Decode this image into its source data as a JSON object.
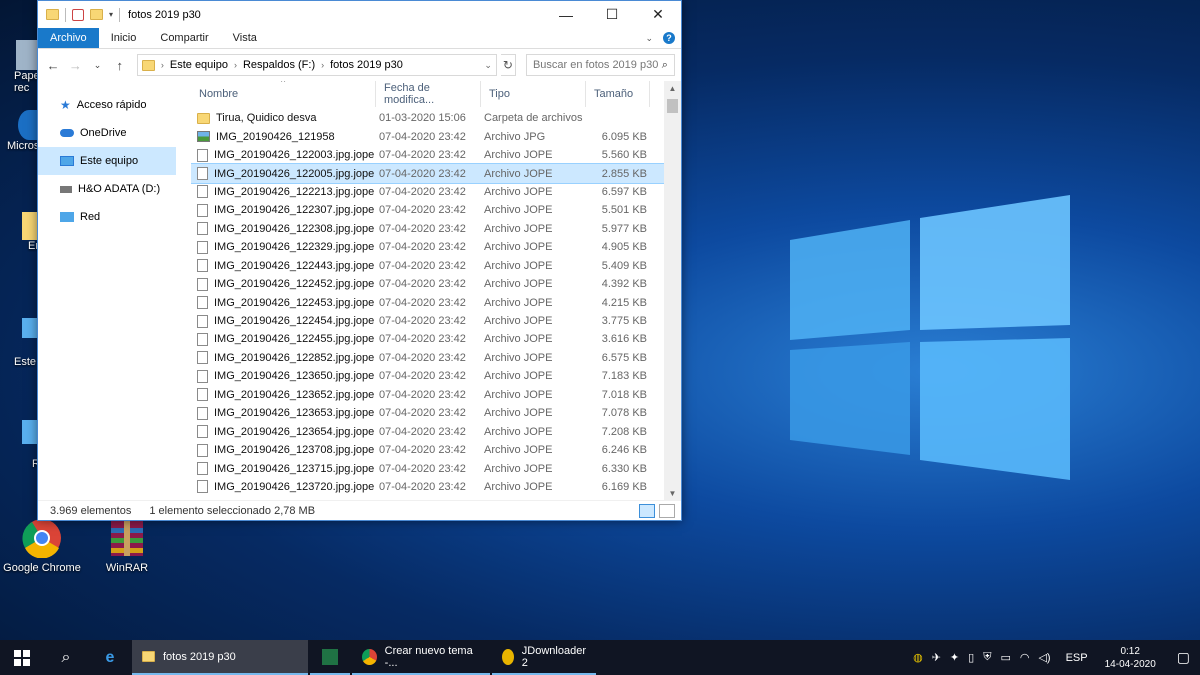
{
  "desktop": {
    "icons": [
      {
        "label": "Pape\nrec",
        "icon": "recycle-bin-icon"
      },
      {
        "label": "Micros",
        "icon": "edge-icon"
      },
      {
        "label": "En",
        "icon": "folder-icon"
      },
      {
        "label": "Este",
        "icon": "this-pc-icon"
      },
      {
        "label": "R",
        "icon": "network-icon"
      },
      {
        "label": "Google Chrome",
        "icon": "chrome-icon"
      },
      {
        "label": "WinRAR",
        "icon": "winrar-icon"
      }
    ]
  },
  "window": {
    "title": "fotos 2019 p30",
    "ribbon_tabs": [
      "Archivo",
      "Inicio",
      "Compartir",
      "Vista"
    ],
    "breadcrumb": [
      "Este equipo",
      "Respaldos (F:)",
      "fotos 2019 p30"
    ],
    "search_placeholder": "Buscar en fotos 2019 p30",
    "nav_pane": [
      {
        "label": "Acceso rápido",
        "icon": "star-icon"
      },
      {
        "label": "OneDrive",
        "icon": "cloud-icon"
      },
      {
        "label": "Este equipo",
        "icon": "computer-icon",
        "selected": true
      },
      {
        "label": "H&O ADATA (D:)",
        "icon": "drive-icon"
      },
      {
        "label": "Red",
        "icon": "network-icon"
      }
    ],
    "columns": [
      "Nombre",
      "Fecha de modifica...",
      "Tipo",
      "Tamaño"
    ],
    "files": [
      {
        "name": "Tirua, Quidico desva",
        "date": "01-03-2020 15:06",
        "type": "Carpeta de archivos",
        "size": "",
        "kind": "folder"
      },
      {
        "name": "IMG_20190426_121958",
        "date": "07-04-2020 23:42",
        "type": "Archivo JPG",
        "size": "6.095 KB",
        "kind": "jpg"
      },
      {
        "name": "IMG_20190426_122003.jpg.jope",
        "date": "07-04-2020 23:42",
        "type": "Archivo JOPE",
        "size": "5.560 KB",
        "kind": "file"
      },
      {
        "name": "IMG_20190426_122005.jpg.jope",
        "date": "07-04-2020 23:42",
        "type": "Archivo JOPE",
        "size": "2.855 KB",
        "kind": "file",
        "selected": true
      },
      {
        "name": "IMG_20190426_122213.jpg.jope",
        "date": "07-04-2020 23:42",
        "type": "Archivo JOPE",
        "size": "6.597 KB",
        "kind": "file"
      },
      {
        "name": "IMG_20190426_122307.jpg.jope",
        "date": "07-04-2020 23:42",
        "type": "Archivo JOPE",
        "size": "5.501 KB",
        "kind": "file"
      },
      {
        "name": "IMG_20190426_122308.jpg.jope",
        "date": "07-04-2020 23:42",
        "type": "Archivo JOPE",
        "size": "5.977 KB",
        "kind": "file"
      },
      {
        "name": "IMG_20190426_122329.jpg.jope",
        "date": "07-04-2020 23:42",
        "type": "Archivo JOPE",
        "size": "4.905 KB",
        "kind": "file"
      },
      {
        "name": "IMG_20190426_122443.jpg.jope",
        "date": "07-04-2020 23:42",
        "type": "Archivo JOPE",
        "size": "5.409 KB",
        "kind": "file"
      },
      {
        "name": "IMG_20190426_122452.jpg.jope",
        "date": "07-04-2020 23:42",
        "type": "Archivo JOPE",
        "size": "4.392 KB",
        "kind": "file"
      },
      {
        "name": "IMG_20190426_122453.jpg.jope",
        "date": "07-04-2020 23:42",
        "type": "Archivo JOPE",
        "size": "4.215 KB",
        "kind": "file"
      },
      {
        "name": "IMG_20190426_122454.jpg.jope",
        "date": "07-04-2020 23:42",
        "type": "Archivo JOPE",
        "size": "3.775 KB",
        "kind": "file"
      },
      {
        "name": "IMG_20190426_122455.jpg.jope",
        "date": "07-04-2020 23:42",
        "type": "Archivo JOPE",
        "size": "3.616 KB",
        "kind": "file"
      },
      {
        "name": "IMG_20190426_122852.jpg.jope",
        "date": "07-04-2020 23:42",
        "type": "Archivo JOPE",
        "size": "6.575 KB",
        "kind": "file"
      },
      {
        "name": "IMG_20190426_123650.jpg.jope",
        "date": "07-04-2020 23:42",
        "type": "Archivo JOPE",
        "size": "7.183 KB",
        "kind": "file"
      },
      {
        "name": "IMG_20190426_123652.jpg.jope",
        "date": "07-04-2020 23:42",
        "type": "Archivo JOPE",
        "size": "7.018 KB",
        "kind": "file"
      },
      {
        "name": "IMG_20190426_123653.jpg.jope",
        "date": "07-04-2020 23:42",
        "type": "Archivo JOPE",
        "size": "7.078 KB",
        "kind": "file"
      },
      {
        "name": "IMG_20190426_123654.jpg.jope",
        "date": "07-04-2020 23:42",
        "type": "Archivo JOPE",
        "size": "7.208 KB",
        "kind": "file"
      },
      {
        "name": "IMG_20190426_123708.jpg.jope",
        "date": "07-04-2020 23:42",
        "type": "Archivo JOPE",
        "size": "6.246 KB",
        "kind": "file"
      },
      {
        "name": "IMG_20190426_123715.jpg.jope",
        "date": "07-04-2020 23:42",
        "type": "Archivo JOPE",
        "size": "6.330 KB",
        "kind": "file"
      },
      {
        "name": "IMG_20190426_123720.jpg.jope",
        "date": "07-04-2020 23:42",
        "type": "Archivo JOPE",
        "size": "6.169 KB",
        "kind": "file"
      }
    ],
    "status": {
      "count": "3.969 elementos",
      "selection": "1 elemento seleccionado  2,78 MB"
    }
  },
  "taskbar": {
    "apps": [
      {
        "label": "fotos 2019 p30",
        "icon": "folder-icon",
        "active": true
      },
      {
        "label": "",
        "icon": "excel-icon"
      },
      {
        "label": "Crear nuevo tema -...",
        "icon": "chrome-icon"
      },
      {
        "label": "JDownloader 2",
        "icon": "jdownloader-icon"
      }
    ],
    "lang": "ESP",
    "time": "0:12",
    "date": "14-04-2020"
  },
  "colors": {
    "accent": "#1979ca",
    "selection": "#cce8ff",
    "taskbar": "#101523"
  }
}
